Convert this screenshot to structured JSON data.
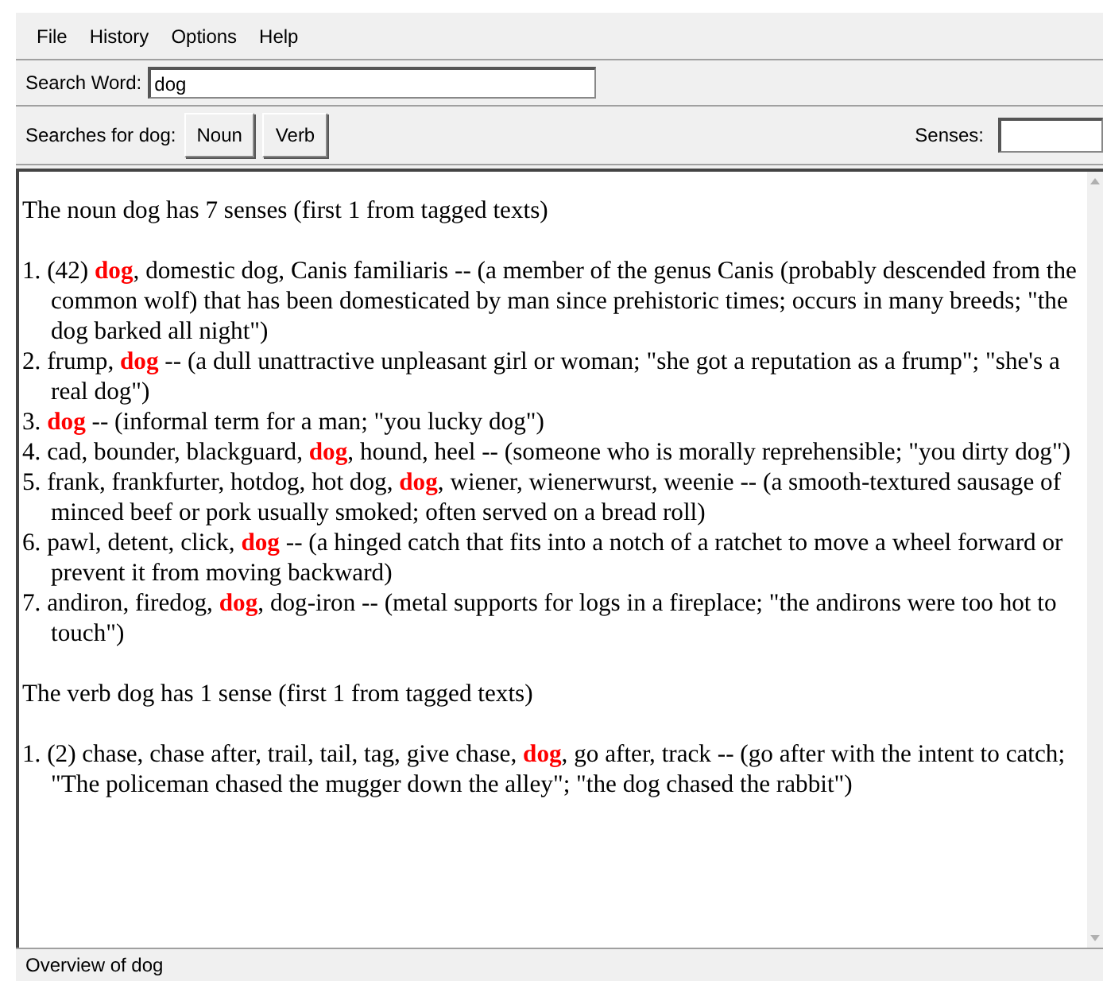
{
  "menu": [
    "File",
    "History",
    "Options",
    "Help"
  ],
  "search": {
    "label": "Search Word:",
    "value": "dog"
  },
  "searches": {
    "label": "Searches for dog:",
    "buttons": [
      "Noun",
      "Verb"
    ]
  },
  "senses": {
    "label": "Senses:"
  },
  "sections": [
    {
      "heading": "The noun dog has 7 senses (first 1 from tagged texts)",
      "entries": [
        "1. (42) **dog**, domestic dog, Canis familiaris -- (a member of the genus Canis (probably descended from the common wolf) that has been domesticated by man since prehistoric times; occurs in many breeds; \"the dog barked all night\")",
        "2. frump, **dog** -- (a dull unattractive unpleasant girl or woman; \"she got a reputation as a frump\"; \"she's a real dog\")",
        "3. **dog** -- (informal term for a man; \"you lucky dog\")",
        "4. cad, bounder, blackguard, **dog**, hound, heel -- (someone who is morally reprehensible; \"you dirty dog\")",
        "5. frank, frankfurter, hotdog, hot dog, **dog**, wiener, wienerwurst, weenie -- (a smooth-textured sausage of minced beef or pork usually smoked; often served on a bread roll)",
        "6. pawl, detent, click, **dog** -- (a hinged catch that fits into a notch of a ratchet to move a wheel forward or prevent it from moving backward)",
        "7. andiron, firedog, **dog**, dog-iron -- (metal supports for logs in a fireplace; \"the andirons were too hot to touch\")"
      ]
    },
    {
      "heading": "The verb dog has 1 sense (first 1 from tagged texts)",
      "entries": [
        "1. (2) chase, chase after, trail, tail, tag, give chase, **dog**, go after, track -- (go after with the intent to catch; \"The policeman chased the mugger down the alley\"; \"the dog chased the rabbit\")"
      ]
    }
  ],
  "status_bar": "Overview of dog"
}
